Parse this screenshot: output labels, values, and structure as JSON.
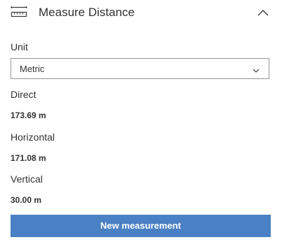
{
  "header": {
    "title": "Measure Distance",
    "icon": "ruler-icon",
    "collapse_icon": "chevron-up-icon"
  },
  "unit": {
    "label": "Unit",
    "selected": "Metric",
    "chevron_icon": "chevron-down-icon"
  },
  "results": {
    "direct_label": "Direct",
    "direct_value": "173.69 m",
    "horizontal_label": "Horizontal",
    "horizontal_value": "171.08 m",
    "vertical_label": "Vertical",
    "vertical_value": "30.00 m"
  },
  "actions": {
    "new_measurement_label": "New measurement"
  },
  "colors": {
    "primary_button": "#4a80c4",
    "text": "#323232",
    "select_border": "#959595"
  }
}
